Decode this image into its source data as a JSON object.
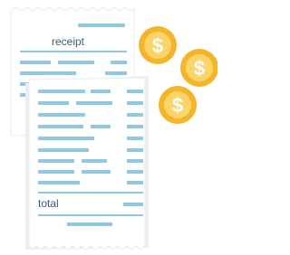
{
  "back_receipt": {
    "title": "receipt"
  },
  "front_receipt": {
    "total_label": "total"
  },
  "coins": {
    "symbol": "$",
    "count": 3
  },
  "colors": {
    "paper": "#ffffff",
    "paper_shadow": "#e9eef2",
    "back_accent": "#8fc8e0",
    "line": "#8fc8e0",
    "text": "#3f5a7a",
    "coin_outer": "#f5b52b",
    "coin_inner": "#fbd46a",
    "coin_symbol": "#ffffff"
  }
}
